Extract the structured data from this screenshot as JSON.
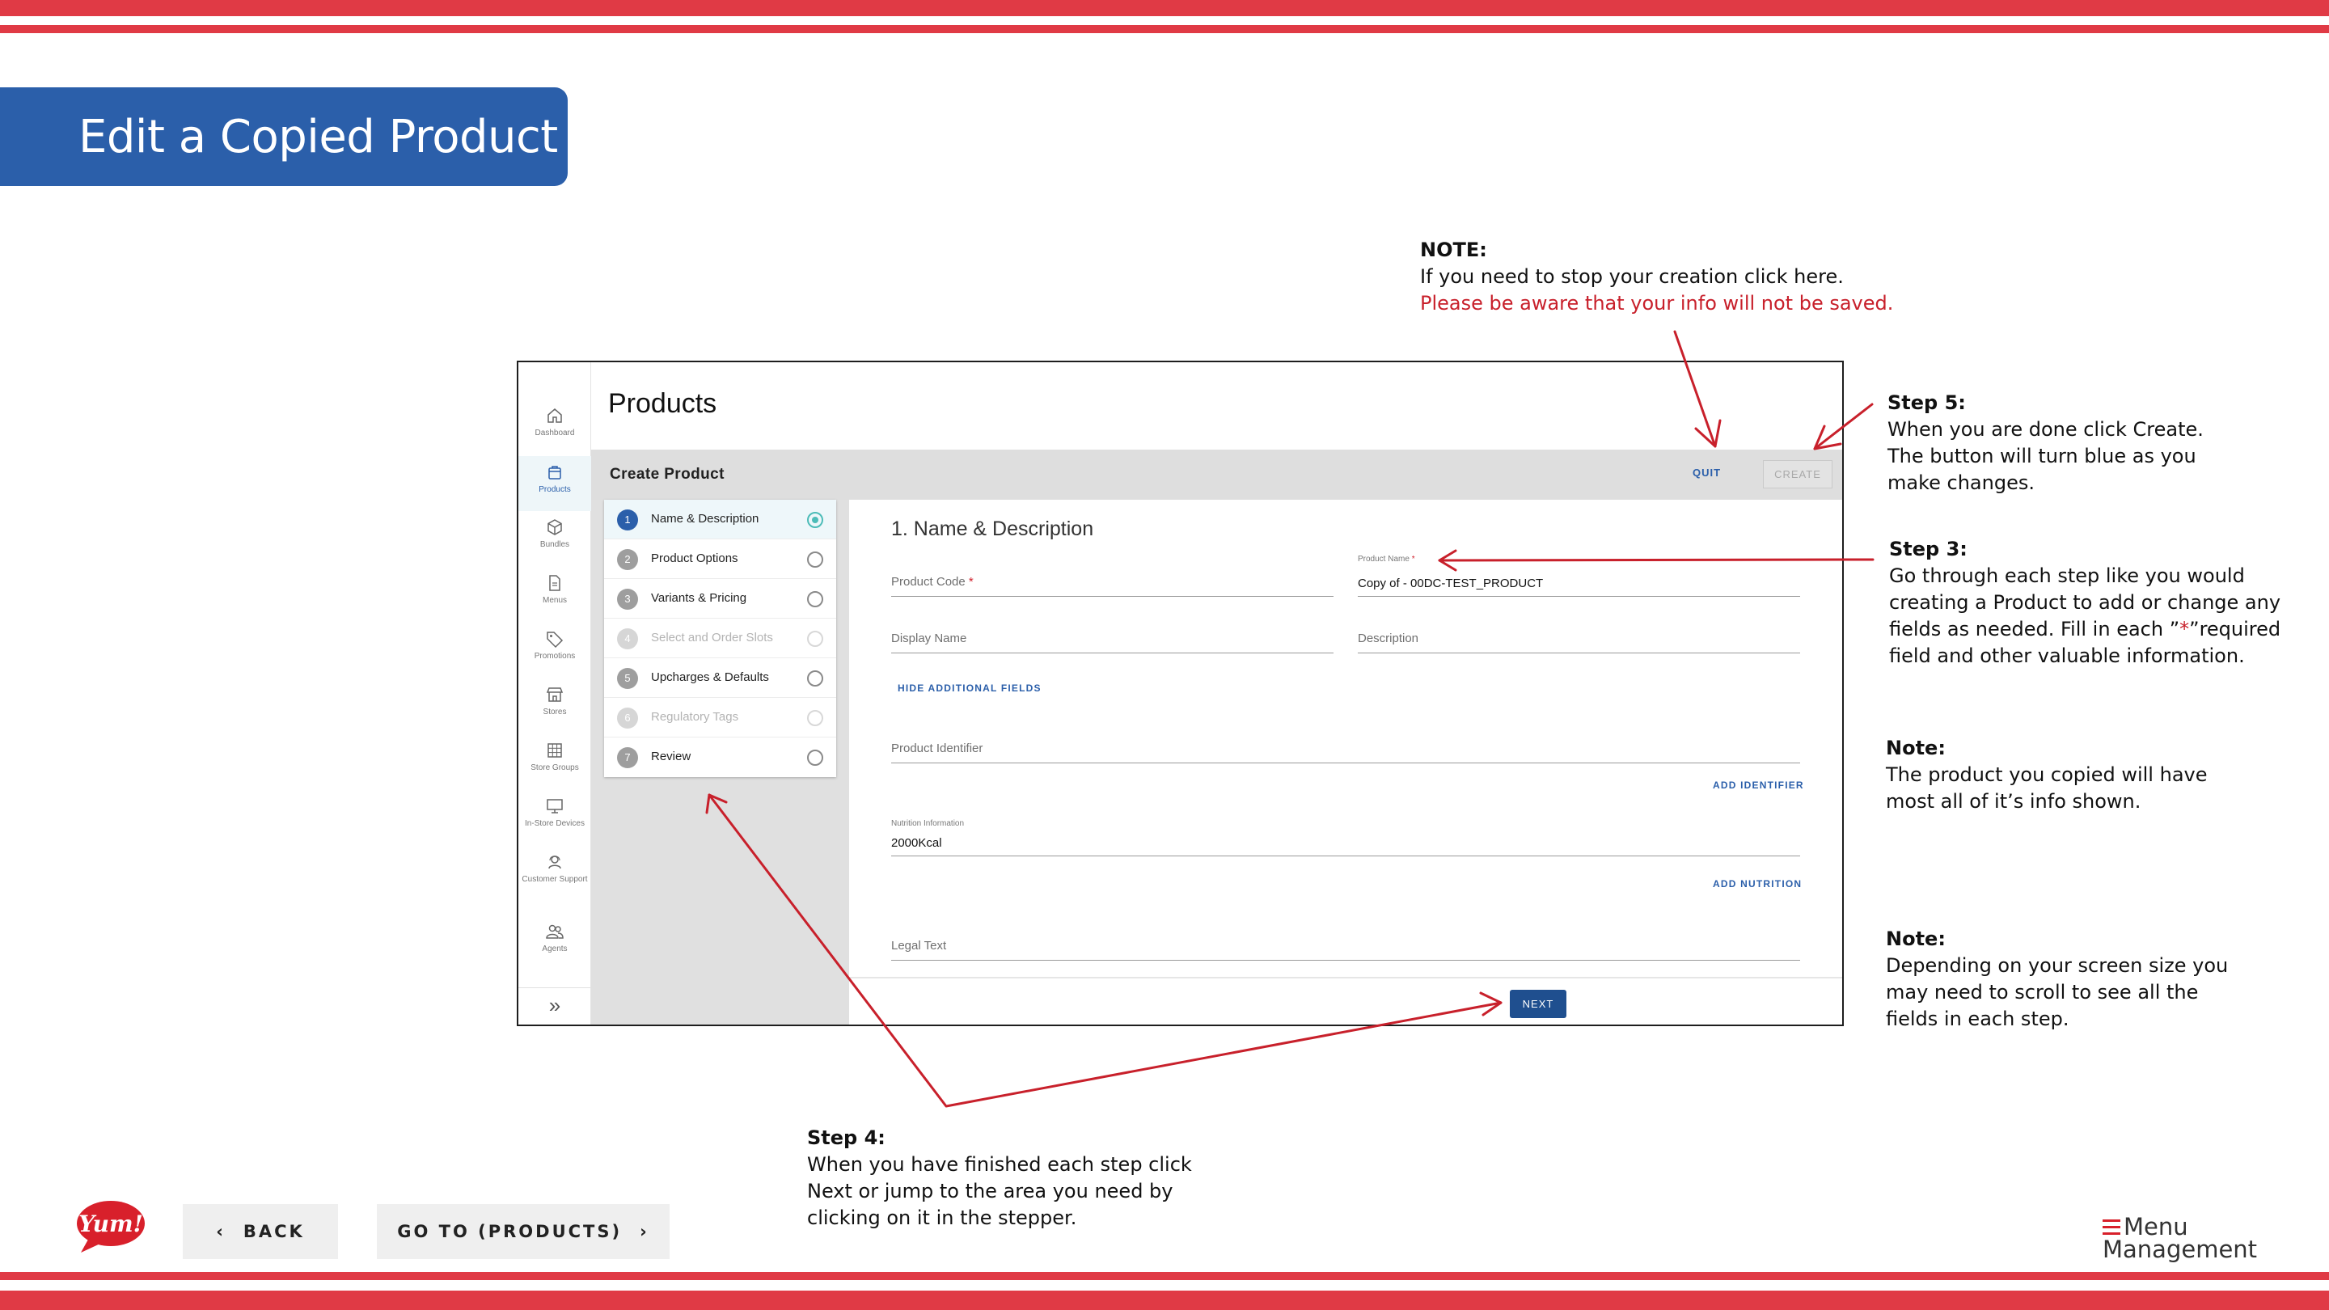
{
  "slide": {
    "title": "Edit a Copied Product",
    "colors": {
      "stripe": "#e03a45",
      "banner": "#2b5faa",
      "annotation_arrow": "#c8202b"
    }
  },
  "app": {
    "page_title": "Products",
    "nav": [
      {
        "label": "Dashboard",
        "icon": "home-icon",
        "active": false
      },
      {
        "label": "Products",
        "icon": "bag-icon",
        "active": true
      },
      {
        "label": "Bundles",
        "icon": "cube-icon",
        "active": false
      },
      {
        "label": "Menus",
        "icon": "document-icon",
        "active": false
      },
      {
        "label": "Promotions",
        "icon": "tag-icon",
        "active": false
      },
      {
        "label": "Stores",
        "icon": "storefront-icon",
        "active": false
      },
      {
        "label": "Store Groups",
        "icon": "grid-icon",
        "active": false
      },
      {
        "label": "In-Store Devices",
        "icon": "monitor-icon",
        "active": false
      },
      {
        "label": "Customer Support",
        "icon": "headset-icon",
        "active": false
      },
      {
        "label": "Agents",
        "icon": "people-icon",
        "active": false
      }
    ],
    "nav_expand_icon": "double-chevron-right-icon",
    "create_bar": {
      "title": "Create Product",
      "quit": "QUIT",
      "create": "CREATE"
    },
    "steps": [
      {
        "num": "1",
        "label": "Name & Description",
        "state": "current"
      },
      {
        "num": "2",
        "label": "Product Options",
        "state": "enabled"
      },
      {
        "num": "3",
        "label": "Variants & Pricing",
        "state": "enabled"
      },
      {
        "num": "4",
        "label": "Select and Order Slots",
        "state": "disabled"
      },
      {
        "num": "5",
        "label": "Upcharges & Defaults",
        "state": "enabled"
      },
      {
        "num": "6",
        "label": "Regulatory Tags",
        "state": "disabled"
      },
      {
        "num": "7",
        "label": "Review",
        "state": "enabled"
      }
    ],
    "form": {
      "heading": "1. Name & Description",
      "product_code": "Product Code",
      "product_name_label": "Product Name",
      "product_name_value": "Copy of - 00DC-TEST_PRODUCT",
      "display_name": "Display Name",
      "description": "Description",
      "hide_fields": "HIDE ADDITIONAL FIELDS",
      "product_identifier": "Product Identifier",
      "add_identifier": "ADD IDENTIFIER",
      "nutrition_label": "Nutrition Information",
      "nutrition_value": "2000Kcal",
      "add_nutrition": "ADD NUTRITION",
      "legal_text": "Legal Text",
      "required_mark": "*",
      "next": "NEXT"
    }
  },
  "annotations": {
    "note_top": {
      "heading": "NOTE:",
      "line1": "If you need to stop your creation click here.",
      "line2": "Please be aware that your info will not be saved."
    },
    "step5": {
      "heading": "Step 5:",
      "lines": [
        "When you are done click Create.",
        "The button will turn blue as you",
        "make changes."
      ]
    },
    "step3": {
      "heading": "Step 3:",
      "line1": "Go through each step like you would",
      "line2": "creating a Product to add or change any",
      "line3_pre": "fields as needed. Fill in each ”",
      "line3_star": "*",
      "line3_post": "”required",
      "line4": "field and other valuable information."
    },
    "note_copied": {
      "heading": "Note:",
      "lines": [
        "The product you copied will have",
        "most all of it’s info shown."
      ]
    },
    "note_scroll": {
      "heading": "Note:",
      "lines": [
        "Depending on your screen size you",
        "may need to scroll to see all the",
        "fields in each step."
      ]
    },
    "step4": {
      "heading": "Step 4:",
      "lines": [
        "When you have finished each step click",
        "Next or jump to the area you need by",
        "clicking on it in the stepper."
      ]
    }
  },
  "footer": {
    "logo_text": "Yum!",
    "back": "BACK",
    "goto": "GO TO (PRODUCTS)",
    "brand_line1": "Menu",
    "brand_line2": "Management"
  }
}
